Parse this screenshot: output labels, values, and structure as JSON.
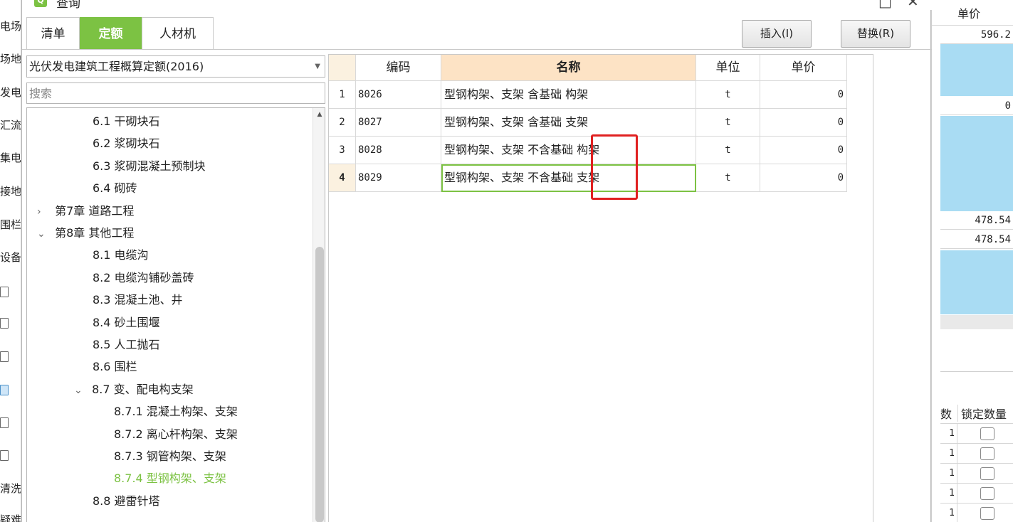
{
  "background_app": {
    "left_items": [
      "电场工",
      "场地",
      "发电",
      "汇流",
      "集电",
      "接地",
      "围栏",
      "设备",
      "清洗",
      "疑难"
    ],
    "right_header": "单价",
    "right_values": [
      "596.2",
      "0",
      "478.54",
      "478.54"
    ],
    "right_lock_headers": [
      "数",
      "锁定数量"
    ],
    "right_lock_values": [
      "1",
      "1",
      "1",
      "1",
      "1"
    ]
  },
  "dialog": {
    "title": "查询",
    "tabs": [
      {
        "label": "清单",
        "active": false
      },
      {
        "label": "定额",
        "active": true
      },
      {
        "label": "人材机",
        "active": false
      }
    ],
    "insert_label": "插入(I)",
    "replace_label": "替换(R)",
    "library_value": "光伏发电建筑工程概算定额(2016)",
    "search_placeholder": "搜索",
    "tree": [
      {
        "label": "6.1 干砌块石",
        "level": 2,
        "toggle": ""
      },
      {
        "label": "6.2 浆砌块石",
        "level": 2,
        "toggle": ""
      },
      {
        "label": "6.3 浆砌混凝土预制块",
        "level": 2,
        "toggle": ""
      },
      {
        "label": "6.4 砌砖",
        "level": 2,
        "toggle": ""
      },
      {
        "label": "第7章 道路工程",
        "level": 1,
        "toggle": "›"
      },
      {
        "label": "第8章 其他工程",
        "level": 1,
        "toggle": "⌄"
      },
      {
        "label": "8.1 电缆沟",
        "level": 2,
        "toggle": ""
      },
      {
        "label": "8.2 电缆沟铺砂盖砖",
        "level": 2,
        "toggle": ""
      },
      {
        "label": "8.3 混凝土池、井",
        "level": 2,
        "toggle": ""
      },
      {
        "label": "8.4 砂土围堰",
        "level": 2,
        "toggle": ""
      },
      {
        "label": "8.5 人工抛石",
        "level": 2,
        "toggle": ""
      },
      {
        "label": "8.6 围栏",
        "level": 2,
        "toggle": ""
      },
      {
        "label": "8.7 变、配电构支架",
        "level": 2,
        "toggle": "⌄"
      },
      {
        "label": "8.7.1 混凝土构架、支架",
        "level": 3,
        "toggle": ""
      },
      {
        "label": "8.7.2 离心杆构架、支架",
        "level": 3,
        "toggle": ""
      },
      {
        "label": "8.7.3 钢管构架、支架",
        "level": 3,
        "toggle": ""
      },
      {
        "label": "8.7.4 型钢构架、支架",
        "level": 3,
        "toggle": "",
        "selected": true
      },
      {
        "label": "8.8 避雷针塔",
        "level": 2,
        "toggle": ""
      }
    ],
    "grid": {
      "headers": {
        "code": "编码",
        "name": "名称",
        "unit": "单位",
        "price": "单价"
      },
      "rows": [
        {
          "num": "1",
          "code": "8026",
          "name": "型钢构架、支架 含基础 构架",
          "unit": "t",
          "price": "0"
        },
        {
          "num": "2",
          "code": "8027",
          "name": "型钢构架、支架 含基础 支架",
          "unit": "t",
          "price": "0"
        },
        {
          "num": "3",
          "code": "8028",
          "name": "型钢构架、支架 不含基础 构架",
          "unit": "t",
          "price": "0"
        },
        {
          "num": "4",
          "code": "8029",
          "name": "型钢构架、支架 不含基础 支架",
          "unit": "t",
          "price": "0"
        }
      ],
      "current_row": 3
    }
  },
  "colors": {
    "accent_green": "#7cc243",
    "highlight_red": "#e02020",
    "header_orange": "#fde3c5"
  }
}
